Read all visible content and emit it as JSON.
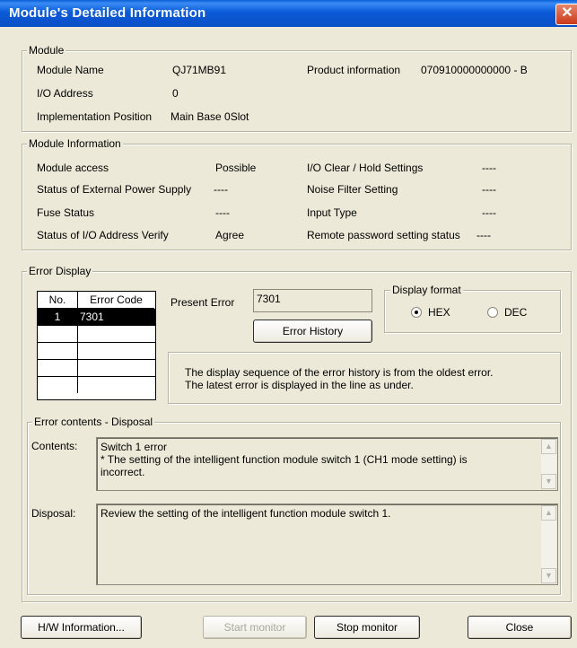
{
  "window": {
    "title": "Module's Detailed Information",
    "close_glyph": "✕"
  },
  "module": {
    "legend": "Module",
    "name_label": "Module Name",
    "name_value": "QJ71MB91",
    "product_label": "Product information",
    "product_value": "070910000000000 - B",
    "io_label": "I/O Address",
    "io_value": "0",
    "impl_label": "Implementation Position",
    "impl_value": "Main Base  0Slot"
  },
  "module_info": {
    "legend": "Module Information",
    "access_label": "Module access",
    "access_value": "Possible",
    "ext_power_label": "Status of External Power Supply",
    "ext_power_value": "----",
    "fuse_label": "Fuse Status",
    "fuse_value": "----",
    "io_verify_label": "Status of I/O Address Verify",
    "io_verify_value": "Agree",
    "io_clear_label": "I/O Clear / Hold Settings",
    "io_clear_value": "----",
    "noise_label": "Noise Filter Setting",
    "noise_value": "----",
    "input_label": "Input Type",
    "input_value": "----",
    "remote_label": "Remote password setting status",
    "remote_value": "----"
  },
  "error_display": {
    "legend": "Error Display",
    "col_no": "No.",
    "col_code": "Error Code",
    "rows": [
      {
        "no": "1",
        "code": "7301"
      }
    ],
    "present_label": "Present Error",
    "present_value": "7301",
    "history_button": "Error History",
    "format_legend": "Display format",
    "hex_label": "HEX",
    "dec_label": "DEC",
    "selected": "HEX",
    "note": "The display sequence of the error history is from the oldest error.\nThe latest error is displayed in the line as under."
  },
  "error_contents": {
    "legend": "Error contents - Disposal",
    "contents_label": "Contents:",
    "contents_text": "Switch 1 error\n* The setting of the intelligent function module switch 1 (CH1 mode setting) is\nincorrect.",
    "disposal_label": "Disposal:",
    "disposal_text": "Review the setting of the intelligent function module switch 1."
  },
  "buttons": {
    "hw_info": "H/W Information...",
    "start_monitor": "Start monitor",
    "stop_monitor": "Stop monitor",
    "close": "Close"
  },
  "icons": {
    "scroll_up": "▲",
    "scroll_down": "▼"
  }
}
